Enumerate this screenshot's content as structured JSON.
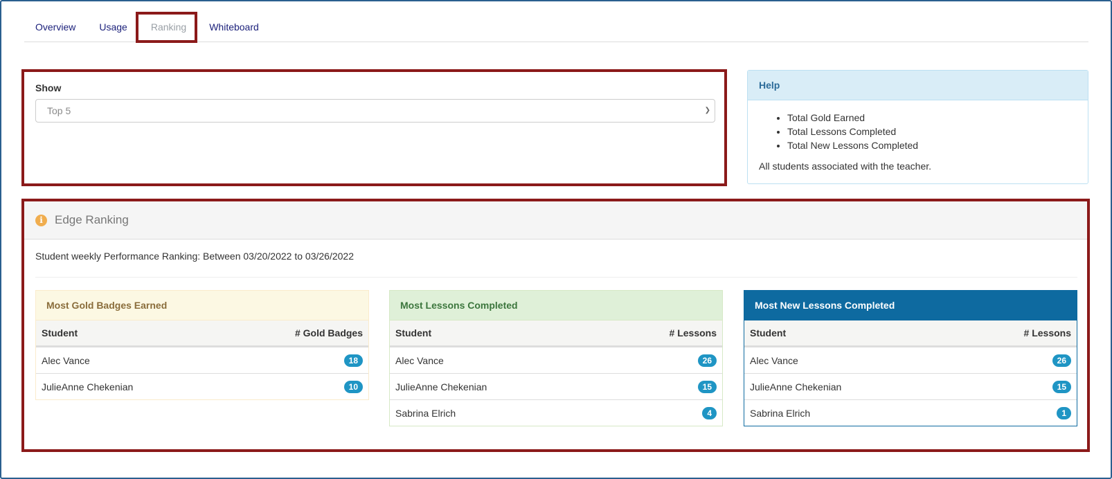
{
  "tabs": [
    {
      "label": "Overview",
      "active": false
    },
    {
      "label": "Usage",
      "active": false
    },
    {
      "label": "Ranking",
      "active": true
    },
    {
      "label": "Whiteboard",
      "active": false
    }
  ],
  "show": {
    "label": "Show",
    "selected": "Top 5"
  },
  "help": {
    "title": "Help",
    "items": [
      "Total Gold Earned",
      "Total Lessons Completed",
      "Total New Lessons Completed"
    ],
    "note": "All students associated with the teacher."
  },
  "edge": {
    "icon": "info-icon",
    "title": "Edge Ranking",
    "description": "Student weekly Performance Ranking: Between 03/20/2022 to 03/26/2022",
    "tables": [
      {
        "title": "Most Gold Badges Earned",
        "col_student": "Student",
        "col_value": "# Gold Badges",
        "rows": [
          {
            "student": "Alec Vance",
            "value": "18"
          },
          {
            "student": "JulieAnne Chekenian",
            "value": "10"
          }
        ]
      },
      {
        "title": "Most Lessons Completed",
        "col_student": "Student",
        "col_value": "# Lessons",
        "rows": [
          {
            "student": "Alec Vance",
            "value": "26"
          },
          {
            "student": "JulieAnne Chekenian",
            "value": "15"
          },
          {
            "student": "Sabrina Elrich",
            "value": "4"
          }
        ]
      },
      {
        "title": "Most New Lessons Completed",
        "col_student": "Student",
        "col_value": "# Lessons",
        "rows": [
          {
            "student": "Alec Vance",
            "value": "26"
          },
          {
            "student": "JulieAnne Chekenian",
            "value": "15"
          },
          {
            "student": "Sabrina Elrich",
            "value": "1"
          }
        ]
      }
    ]
  },
  "colors": {
    "highlight_border": "#8b1a1a",
    "tab_link": "#1a1f7a",
    "badge": "#1f95c4",
    "primary_header": "#0e6aa0"
  }
}
